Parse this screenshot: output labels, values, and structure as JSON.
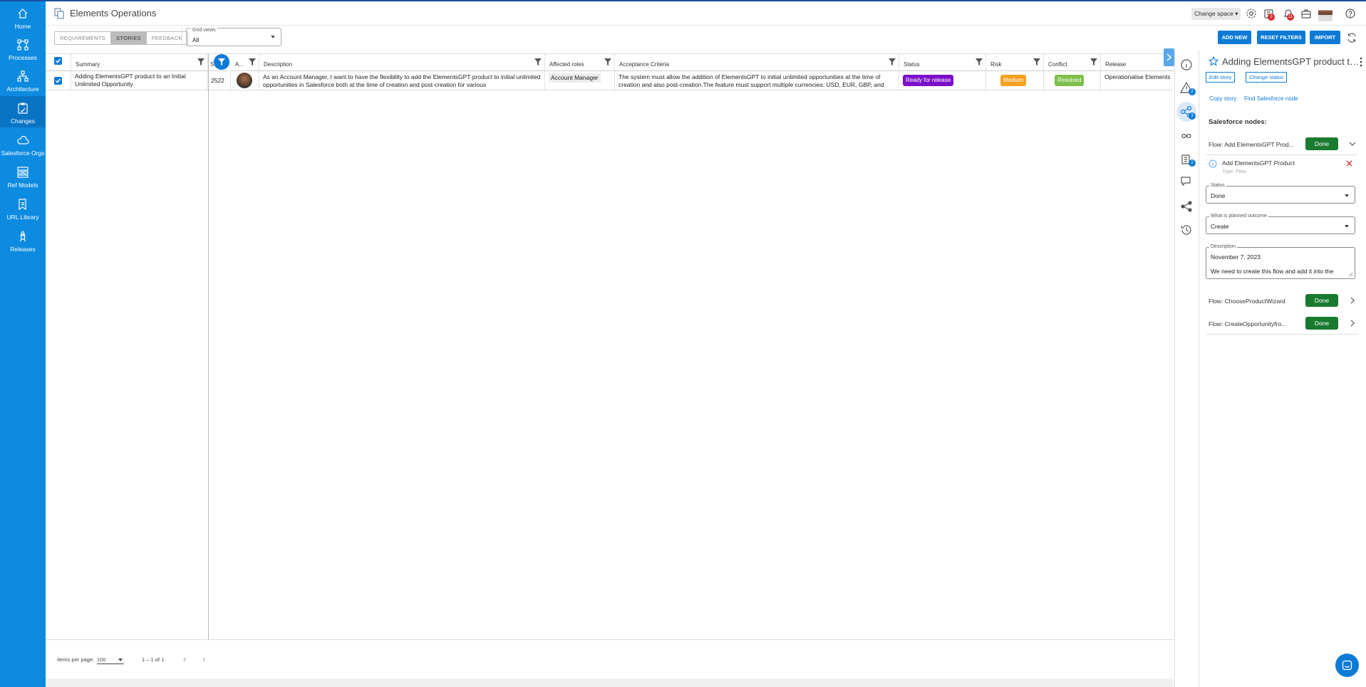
{
  "app": {
    "title": "Elements Operations",
    "change_space": "Change space ▾"
  },
  "sidebar": {
    "items": [
      {
        "label": "Home",
        "icon": "home-icon"
      },
      {
        "label": "Processes",
        "icon": "processes-icon"
      },
      {
        "label": "Architecture",
        "icon": "architecture-icon"
      },
      {
        "label": "Changes",
        "icon": "changes-icon"
      },
      {
        "label": "Salesforce Orgs",
        "icon": "cloud-icon"
      },
      {
        "label": "Ref Models",
        "icon": "ref-models-icon"
      },
      {
        "label": "URL Library",
        "icon": "url-library-icon"
      },
      {
        "label": "Releases",
        "icon": "releases-icon"
      }
    ]
  },
  "header": {
    "badges": {
      "notifications_a": "3",
      "notifications_b": "11"
    }
  },
  "toolbar": {
    "tabs": [
      "REQUIREMENTS",
      "STORIES",
      "FEEDBACK"
    ],
    "grid_views_label": "Grid views",
    "grid_views_value": "All",
    "add_new": "ADD NEW",
    "reset_filters": "RESET FILTERS",
    "import": "IMPORT"
  },
  "grid": {
    "columns": [
      "Summary",
      "St",
      "A...",
      "Description",
      "Affected roles",
      "Acceptance Criteria",
      "Status",
      "Risk",
      "Conflict",
      "Release"
    ],
    "row": {
      "summary": "Adding ElementsGPT product to an Initial Unlimited Opportunity",
      "story_id": "2522",
      "description": "As an Account Manager, I want to have the flexibility to add the ElementsGPT product to initial unlimited opportunities in Salesforce both at the time of creation and post-creation for various",
      "affected_roles": "Account Manager",
      "acceptance_criteria": "The system must allow the addition of ElementsGPT to initial unlimited opportunities at the time of creation and also post-creation.The feature must support multiple currencies: USD, EUR, GBP, and",
      "status": "Ready for release",
      "risk": "Medium",
      "conflict": "Resolved",
      "release": "Operationalise Elements"
    }
  },
  "footer": {
    "items_per_page_label": "Items per page:",
    "items_per_page": "100",
    "range": "1 – 1 of 1"
  },
  "panel": {
    "title": "Adding ElementsGPT product to...",
    "edit_story": "Edit story",
    "change_status": "Change status",
    "copy_story": "Copy story",
    "find_node": "Find Salesforce node",
    "section": "Salesforce nodes:",
    "strip_badges": {
      "warnings": "2",
      "nodes": "3",
      "docs": "2"
    },
    "nodes": [
      {
        "name": "Flow: Add ElementsGPT Prod...",
        "status": "Done"
      },
      {
        "name": "Flow: ChooseProductWizard",
        "status": "Done"
      },
      {
        "name": "Flow: CreateOpportunityfro...",
        "status": "Done"
      }
    ],
    "expanded": {
      "node_name": "Add ElementsGPT Product",
      "node_type": "Type: Flow",
      "status_label": "Status",
      "status_value": "Done",
      "outcome_label": "What is planned outcome",
      "outcome_value": "Create",
      "description_label": "Description",
      "description_line1": "November 7, 2023",
      "description_line2": "We need to create this flow and add it into the"
    }
  },
  "colors": {
    "brand": "#0d8be0",
    "status_purple": "#7b0fc8",
    "risk_orange": "#f5a020",
    "conflict_green": "#7cbf4a",
    "done_green": "#1a7a30"
  }
}
